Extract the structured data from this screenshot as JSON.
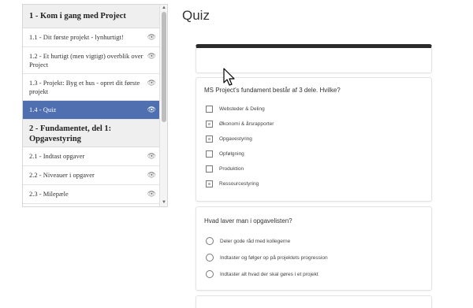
{
  "sidebar": {
    "section1": "1 - Kom i gang med Project",
    "items1": [
      {
        "label": "1.1 - Dit første projekt - lynhurtigt!"
      },
      {
        "label": "1.2 - Et hurtigt (men vigtigt) overblik over Project"
      },
      {
        "label": "1.3 - Projekt: Byg et hus - opret dit første projekt"
      },
      {
        "label": "1.4 - Quiz"
      }
    ],
    "section2": "2 - Fundamentet, del 1: Opgavestyring",
    "items2": [
      {
        "label": "2.1 - Indtast opgaver"
      },
      {
        "label": "2.2 - Niveauer i opgaver"
      },
      {
        "label": "2.3 - Milepæle"
      }
    ],
    "eye_icon": "👁"
  },
  "main": {
    "title": "Quiz",
    "q1": {
      "text": "MS Project's fundament består af 3 dele. Hvilke?",
      "options": [
        "Websteder & Deling",
        "Økonomi & årsrapporter",
        "Opgavestyring",
        "Opfølgning",
        "Produktion",
        "Ressourcestyring"
      ]
    },
    "q2": {
      "text": "Hvad laver man i opgavelisten?",
      "options": [
        "Deler gode råd med kollegerne",
        "Indtaster og følger op på projektets progression",
        "Indtaster alt hvad der skal gøres i et projekt"
      ]
    }
  }
}
